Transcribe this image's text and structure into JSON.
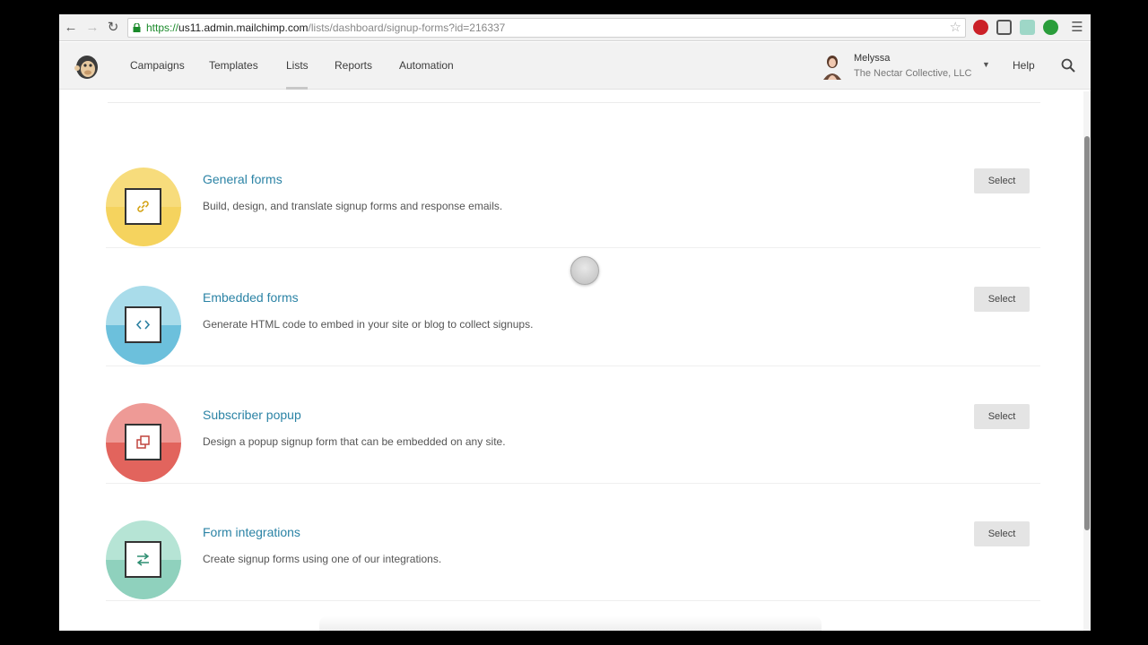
{
  "browser": {
    "url_scheme": "https://",
    "url_domain": "us11.admin.mailchimp.com",
    "url_path": "/lists/dashboard/signup-forms?id=216337",
    "back_glyph": "←",
    "forward_glyph": "→",
    "reload_glyph": "↻",
    "bookmark_glyph": "☆",
    "menu_glyph": "☰",
    "extension_icons": [
      "pinterest-icon",
      "pocket-icon",
      "extension-icon",
      "evernote-icon"
    ]
  },
  "app_nav": {
    "items": [
      {
        "label": "Campaigns"
      },
      {
        "label": "Templates"
      },
      {
        "label": "Lists",
        "active": true
      },
      {
        "label": "Reports"
      },
      {
        "label": "Automation"
      }
    ],
    "user_name": "Melyssa",
    "user_org": "The Nectar Collective, LLC",
    "caret_glyph": "▼",
    "help_label": "Help"
  },
  "form_types": [
    {
      "title": "General forms",
      "description": "Build, design, and translate signup forms and response emails.",
      "button": "Select",
      "icon": "link-icon",
      "color_top": "#f7dc7c",
      "color_bottom": "#f5d35e"
    },
    {
      "title": "Embedded forms",
      "description": "Generate HTML code to embed in your site or blog to collect signups.",
      "button": "Select",
      "icon": "code-icon",
      "color_top": "#a9dcea",
      "color_bottom": "#6cc0dc"
    },
    {
      "title": "Subscriber popup",
      "description": "Design a popup signup form that can be embedded on any site.",
      "button": "Select",
      "icon": "popup-icon",
      "color_top": "#ee9a96",
      "color_bottom": "#e2645d"
    },
    {
      "title": "Form integrations",
      "description": "Create signup forms using one of our integrations.",
      "button": "Select",
      "icon": "swap-arrows-icon",
      "color_top": "#b6e4d5",
      "color_bottom": "#8fd1bd"
    }
  ],
  "colors": {
    "link": "#2b83a5",
    "url_https": "#1a8a2a"
  }
}
